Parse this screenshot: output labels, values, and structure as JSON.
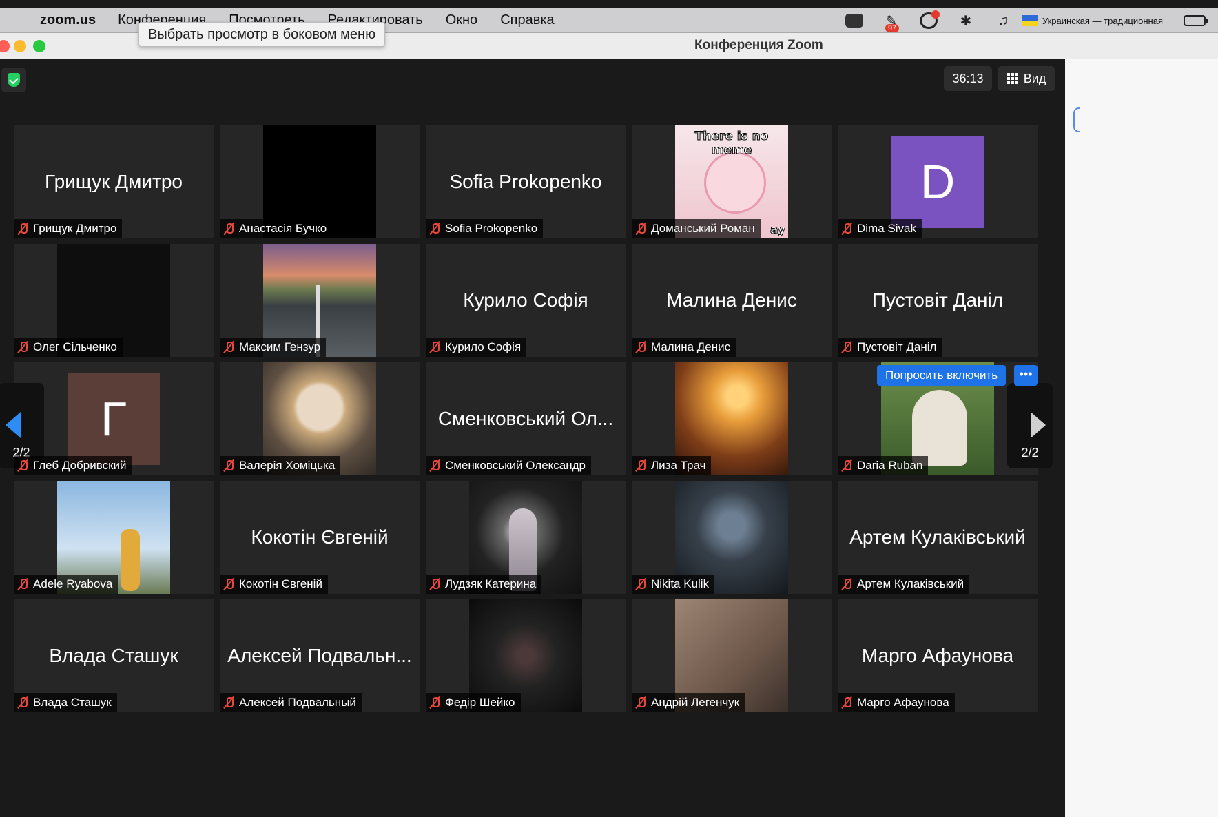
{
  "menubar": {
    "app_name": "zoom.us",
    "items": [
      "Конференция",
      "Посмотреть",
      "Редактировать",
      "Окно",
      "Справка"
    ],
    "badge": "97",
    "language": "Украинская — традиционная"
  },
  "window": {
    "title": "Конференция Zoom"
  },
  "tooltip": "Выбрать просмотр в боковом меню",
  "topbar": {
    "timer": "36:13",
    "view_label": "Вид"
  },
  "pager": {
    "left": "2/2",
    "right": "2/2"
  },
  "ask_button": "Попросить включить",
  "more_button": "•••",
  "meme": {
    "top": "There is no meme",
    "bottom": "ay"
  },
  "tiles": [
    {
      "name": "Грищук Дмитро",
      "kind": "name",
      "display": "Грищук Дмитро"
    },
    {
      "name": "Анастасія Бучко",
      "kind": "black"
    },
    {
      "name": "Sofia Prokopenko",
      "kind": "name",
      "display": "Sofia Prokopenko"
    },
    {
      "name": "Доманський Роман",
      "kind": "meme"
    },
    {
      "name": "Dima Sivak",
      "kind": "avatar",
      "letter": "D",
      "color": "#7b53c1"
    },
    {
      "name": "Олег Сільченко",
      "kind": "dark"
    },
    {
      "name": "Максим Гензур",
      "kind": "photo",
      "photo": "p-road"
    },
    {
      "name": "Курило Софія",
      "kind": "name",
      "display": "Курило Софія"
    },
    {
      "name": "Малина Денис",
      "kind": "name",
      "display": "Малина Денис"
    },
    {
      "name": "Пустовіт Даніл",
      "kind": "name",
      "display": "Пустовіт Даніл"
    },
    {
      "name": "Глеб Добривский",
      "kind": "avatar",
      "letter": "Г",
      "color": "#5b3e37"
    },
    {
      "name": "Валерія Хоміцька",
      "kind": "photo",
      "photo": "p-blonde"
    },
    {
      "name": "Сменковський Олександр",
      "kind": "name",
      "display": "Сменковський Ол..."
    },
    {
      "name": "Лиза Трач",
      "kind": "photo",
      "photo": "p-heart"
    },
    {
      "name": "Daria Ruban",
      "kind": "photo",
      "photo": "p-daria"
    },
    {
      "name": "Adele Ryabova",
      "kind": "photo",
      "photo": "p-eiffel"
    },
    {
      "name": "Кокотін Євгеній",
      "kind": "name",
      "display": "Кокотін Євгеній"
    },
    {
      "name": "Лудзяк Катерина",
      "kind": "photo",
      "photo": "p-dress"
    },
    {
      "name": "Nikita Kulik",
      "kind": "photo",
      "photo": "p-nikita"
    },
    {
      "name": "Артем Кулаківський",
      "kind": "name",
      "display": "Артем Кулаківський"
    },
    {
      "name": "Влада Сташук",
      "kind": "name",
      "display": "Влада Сташук"
    },
    {
      "name": "Алексей Подвальный",
      "kind": "name",
      "display": "Алексей Подвальн..."
    },
    {
      "name": "Федір Шейко",
      "kind": "photo",
      "photo": "p-anime"
    },
    {
      "name": "Андрій Легенчук",
      "kind": "photo",
      "photo": "p-andriy"
    },
    {
      "name": "Марго Афаунова",
      "kind": "name",
      "display": "Марго Афаунова"
    }
  ]
}
